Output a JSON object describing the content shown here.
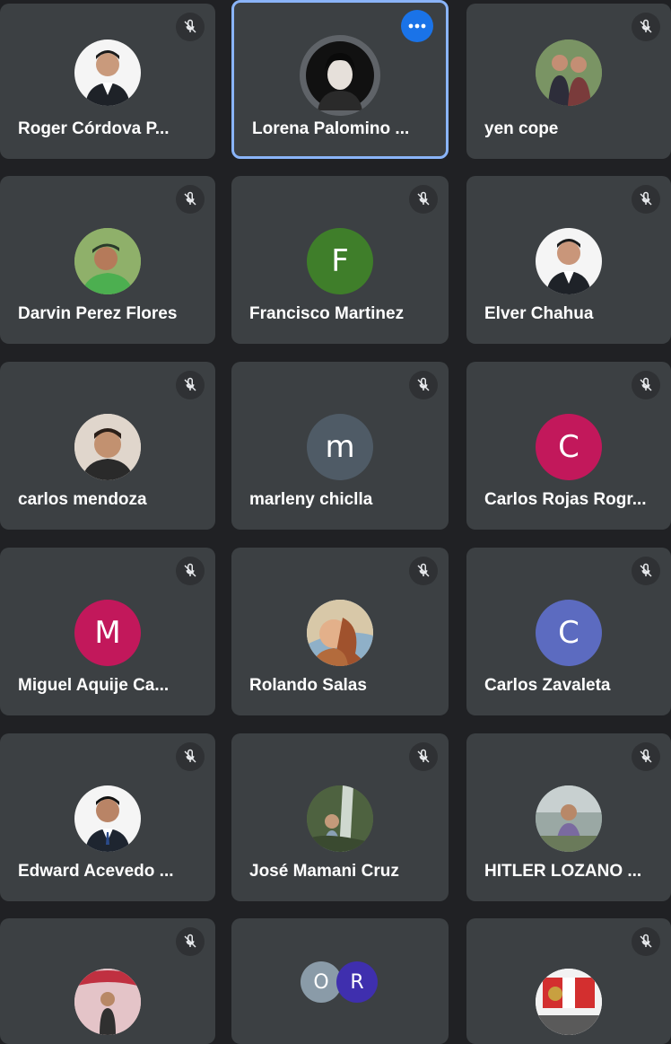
{
  "participants": [
    {
      "name": "Roger Córdova P...",
      "avatar": "photo",
      "muted": true
    },
    {
      "name": "Lorena Palomino ...",
      "avatar": "photo",
      "muted": false,
      "active": true
    },
    {
      "name": "yen cope",
      "avatar": "photo",
      "muted": true
    },
    {
      "name": "Darvin Perez Flores",
      "avatar": "photo",
      "muted": true
    },
    {
      "name": "Francisco Martinez",
      "avatar": "F",
      "avatar_color": "#3f7e2a",
      "muted": true
    },
    {
      "name": "Elver Chahua",
      "avatar": "photo",
      "muted": true
    },
    {
      "name": "carlos mendoza",
      "avatar": "photo",
      "muted": true
    },
    {
      "name": "marleny chiclla",
      "avatar": "m",
      "avatar_color": "#4f5b66",
      "muted": true
    },
    {
      "name": "Carlos Rojas Rogr...",
      "avatar": "C",
      "avatar_color": "#c2185b",
      "muted": true
    },
    {
      "name": "Miguel Aquije Ca...",
      "avatar": "M",
      "avatar_color": "#c2185b",
      "muted": true
    },
    {
      "name": "Rolando Salas",
      "avatar": "photo",
      "muted": true
    },
    {
      "name": "Carlos Zavaleta",
      "avatar": "C",
      "avatar_color": "#5c6bc0",
      "muted": true
    },
    {
      "name": "Edward Acevedo ...",
      "avatar": "photo",
      "muted": true
    },
    {
      "name": "José Mamani Cruz",
      "avatar": "photo",
      "muted": true
    },
    {
      "name": "HITLER LOZANO ...",
      "avatar": "photo",
      "muted": true
    },
    {
      "name": "",
      "avatar": "photo",
      "muted": true
    },
    {
      "name": "",
      "avatar_group": [
        "O",
        "R"
      ],
      "muted": false
    },
    {
      "name": "",
      "avatar": "photo",
      "muted": true
    }
  ],
  "group_avatar": {
    "first": "O",
    "second": "R",
    "first_color": "#8a9ba8",
    "second_color": "#3f2fae"
  },
  "letters": {
    "francisco": "F",
    "marleny": "m",
    "carlos_rojas": "C",
    "miguel": "M",
    "carlos_zavaleta": "C"
  },
  "colors": {
    "background": "#202124",
    "tile": "#3c4043",
    "active_border": "#8ab4f8",
    "more_button": "#1a73e8"
  },
  "icons": {
    "mute": "mic-off-icon",
    "more": "more-options-icon"
  }
}
